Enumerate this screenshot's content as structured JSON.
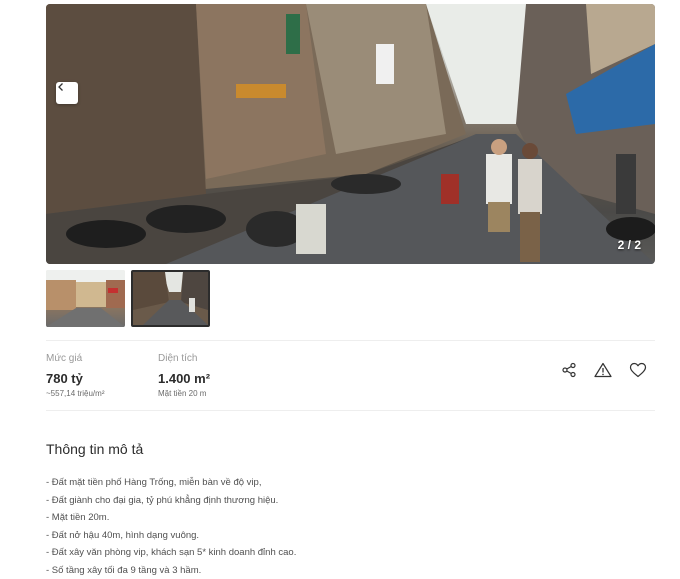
{
  "gallery": {
    "counter": "2 / 2",
    "prev_icon": "chevron-left-icon",
    "thumbnails": [
      {
        "name": "thumbnail-1",
        "selected": false
      },
      {
        "name": "thumbnail-2",
        "selected": true
      }
    ]
  },
  "stats": {
    "price": {
      "label": "Mức giá",
      "value": "780 tỷ",
      "sub": "~557,14 triệu/m²"
    },
    "area": {
      "label": "Diện tích",
      "value": "1.400 m²",
      "sub": "Mặt tiền 20 m"
    }
  },
  "actions": {
    "share_icon": "share-icon",
    "report_icon": "warning-icon",
    "save_icon": "heart-icon"
  },
  "description": {
    "title": "Thông tin mô tả",
    "lines": [
      "- Đất mặt tiền phố Hàng Trống, miễn bàn về độ vip,",
      "- Đất giành cho đại gia, tỷ phú khẳng định thương hiệu.",
      "- Mặt tiền 20m.",
      "- Đất nở hậu 40m, hình dạng vuông.",
      "- Đất xây văn phòng vip, khách sạn 5* kinh doanh đỉnh cao.",
      "- Số tầng xây tối đa 9 tầng và 3 hầm."
    ]
  },
  "colors": {
    "text": "#2c2c2c",
    "muted": "#999999",
    "divider": "#eeeeee"
  }
}
